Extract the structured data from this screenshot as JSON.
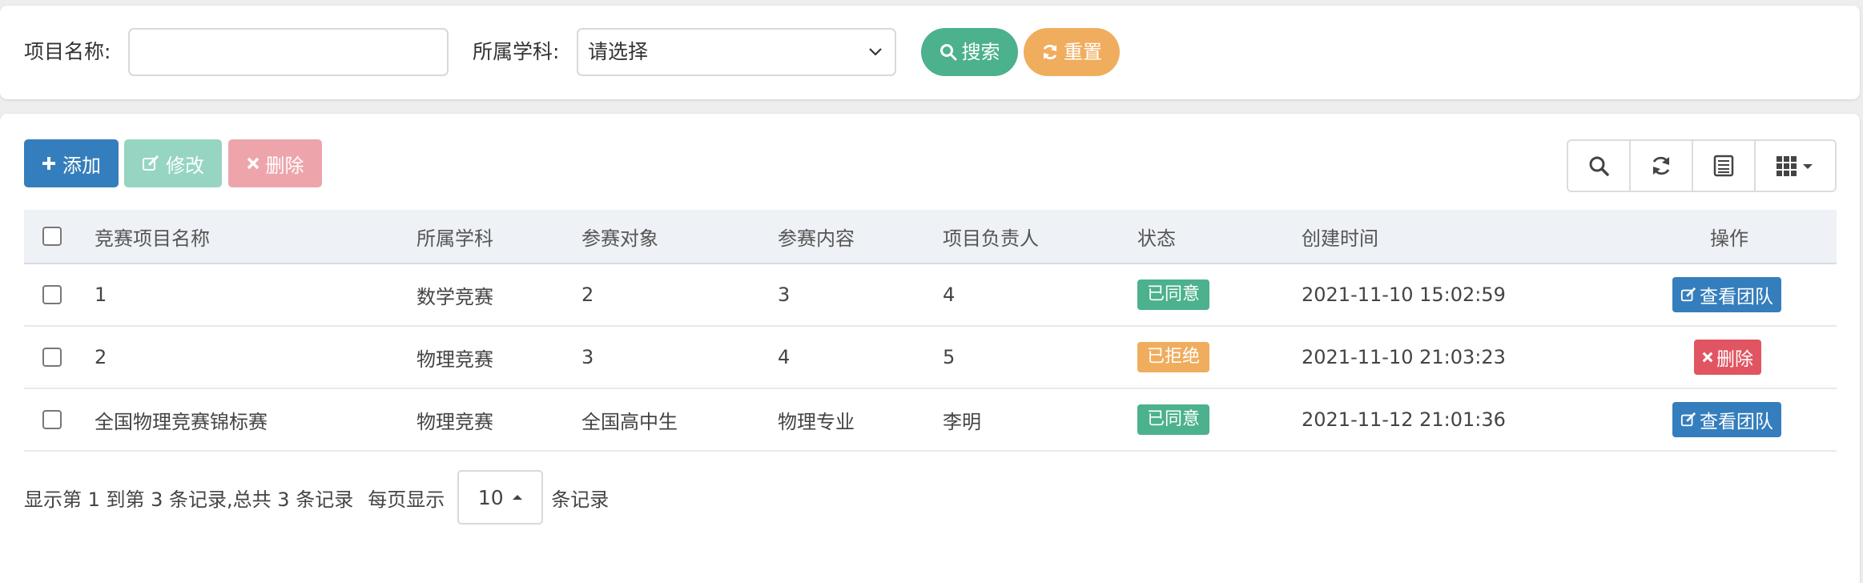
{
  "search": {
    "project_name_label": "项目名称:",
    "project_name_value": "",
    "subject_label": "所属学科:",
    "subject_selected": "请选择",
    "search_label": "搜索",
    "reset_label": "重置"
  },
  "toolbar": {
    "add_label": "添加",
    "edit_label": "修改",
    "delete_label": "删除"
  },
  "table": {
    "headers": {
      "name": "竞赛项目名称",
      "subject": "所属学科",
      "target": "参赛对象",
      "content": "参赛内容",
      "leader": "项目负责人",
      "status": "状态",
      "created": "创建时间",
      "actions": "操作"
    },
    "rows": [
      {
        "name": "1",
        "subject": "数学竞赛",
        "target": "2",
        "content": "3",
        "leader": "4",
        "status": "已同意",
        "created": "2021-11-10 15:02:59",
        "action": "查看团队"
      },
      {
        "name": "2",
        "subject": "物理竞赛",
        "target": "3",
        "content": "4",
        "leader": "5",
        "status": "已拒绝",
        "created": "2021-11-10 21:03:23",
        "action": "删除"
      },
      {
        "name": "全国物理竞赛锦标赛",
        "subject": "物理竞赛",
        "target": "全国高中生",
        "content": "物理专业",
        "leader": "李明",
        "status": "已同意",
        "created": "2021-11-12 21:01:36",
        "action": "查看团队"
      }
    ]
  },
  "pager": {
    "summary": "显示第 1 到第 3 条记录,总共 3 条记录",
    "per_page_prefix": "每页显示",
    "page_size": "10",
    "per_page_suffix": "条记录"
  },
  "colors": {
    "primary": "#357ebd",
    "success": "#4cb18d",
    "warning": "#f0ad5e",
    "danger": "#e05561",
    "header_bg": "#eef1f6"
  },
  "icons": {
    "search": "search-icon",
    "reset": "refresh-icon",
    "add": "plus-icon",
    "edit": "edit-icon",
    "delete": "times-icon",
    "toolbar": [
      "search-icon",
      "refresh-icon",
      "list-icon",
      "grid-icon"
    ]
  }
}
